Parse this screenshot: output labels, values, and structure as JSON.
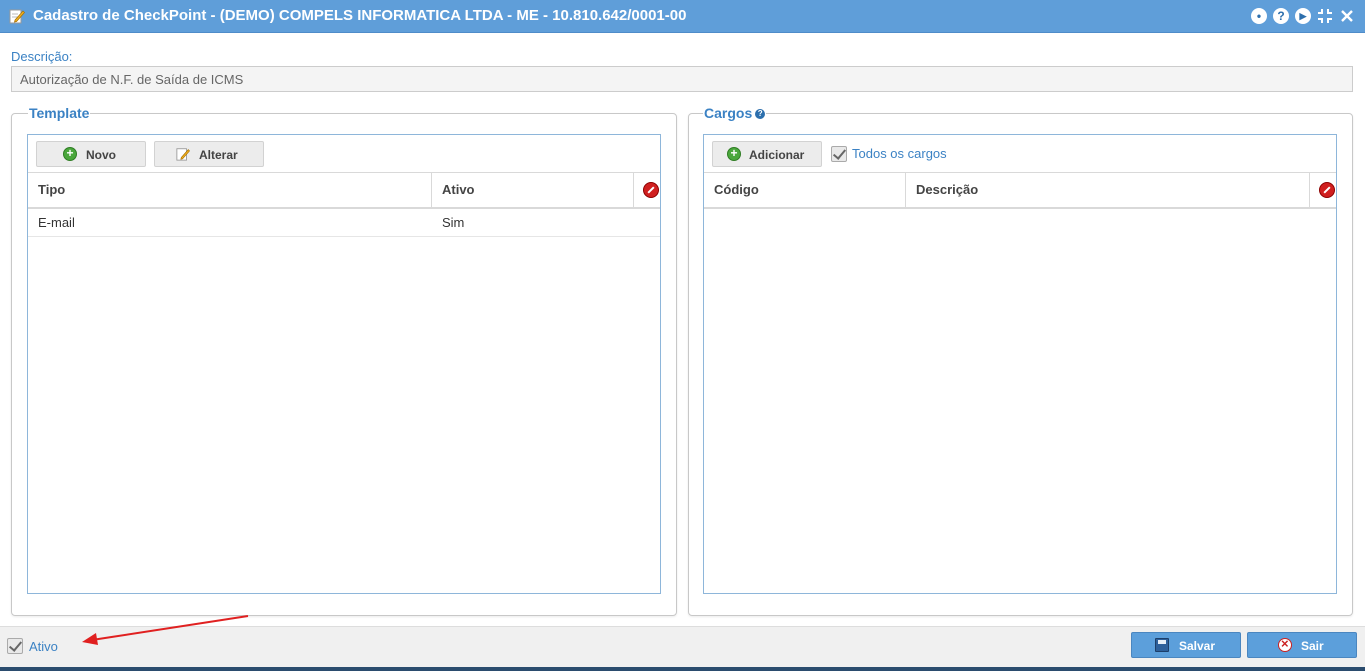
{
  "window": {
    "title": "Cadastro de CheckPoint - (DEMO) COMPELS INFORMATICA LTDA - ME - 10.810.642/0001-00",
    "icons": [
      "edit-icon",
      "chat-icon",
      "help-icon",
      "play-icon",
      "compress-icon",
      "close-icon"
    ]
  },
  "descricao": {
    "label": "Descrição:",
    "value": "Autorização de N.F. de Saída de ICMS"
  },
  "template": {
    "legend": "Template",
    "toolbar": {
      "novo_label": "Novo",
      "alterar_label": "Alterar"
    },
    "columns": [
      "Tipo",
      "Ativo"
    ],
    "rows": [
      {
        "tipo": "E-mail",
        "ativo": "Sim"
      }
    ]
  },
  "cargos": {
    "legend": "Cargos",
    "toolbar": {
      "adicionar_label": "Adicionar",
      "todos_label": "Todos os cargos"
    },
    "columns": [
      "Código",
      "Descrição"
    ],
    "rows": []
  },
  "footer": {
    "ativo_label": "Ativo",
    "salvar_label": "Salvar",
    "sair_label": "Sair"
  },
  "colors": {
    "titlebar": "#5f9ed9",
    "accent_text": "#3b82c4",
    "annotation_arrow": "#e02020"
  }
}
